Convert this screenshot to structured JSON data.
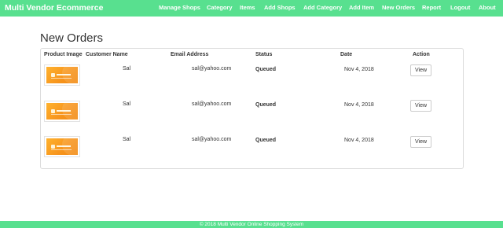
{
  "navbar": {
    "brand": "Multi Vendor Ecommerce",
    "items": [
      "Manage Shops",
      "Category",
      "Items",
      "Add Shops",
      "Add Category",
      "Add Item",
      "New Orders",
      "Report",
      "Logout",
      "About"
    ]
  },
  "page": {
    "title": "New Orders"
  },
  "table": {
    "headers": [
      "Product Image",
      "Customer Name",
      "Email Address",
      "Status",
      "Date",
      "Action"
    ],
    "rows": [
      {
        "customer": "Sal",
        "email": "sal@yahoo.com",
        "status": "Queued",
        "date": "Nov 4, 2018",
        "action": "View"
      },
      {
        "customer": "Sal",
        "email": "sal@yahoo.com",
        "status": "Queued",
        "date": "Nov 4, 2018",
        "action": "View"
      },
      {
        "customer": "Sal",
        "email": "sal@yahoo.com",
        "status": "Queued",
        "date": "Nov 4, 2018",
        "action": "View"
      }
    ]
  },
  "footer": {
    "text": "© 2018 Multi Vendor Online Shopping System"
  },
  "colors": {
    "accent": "#58e08f"
  }
}
